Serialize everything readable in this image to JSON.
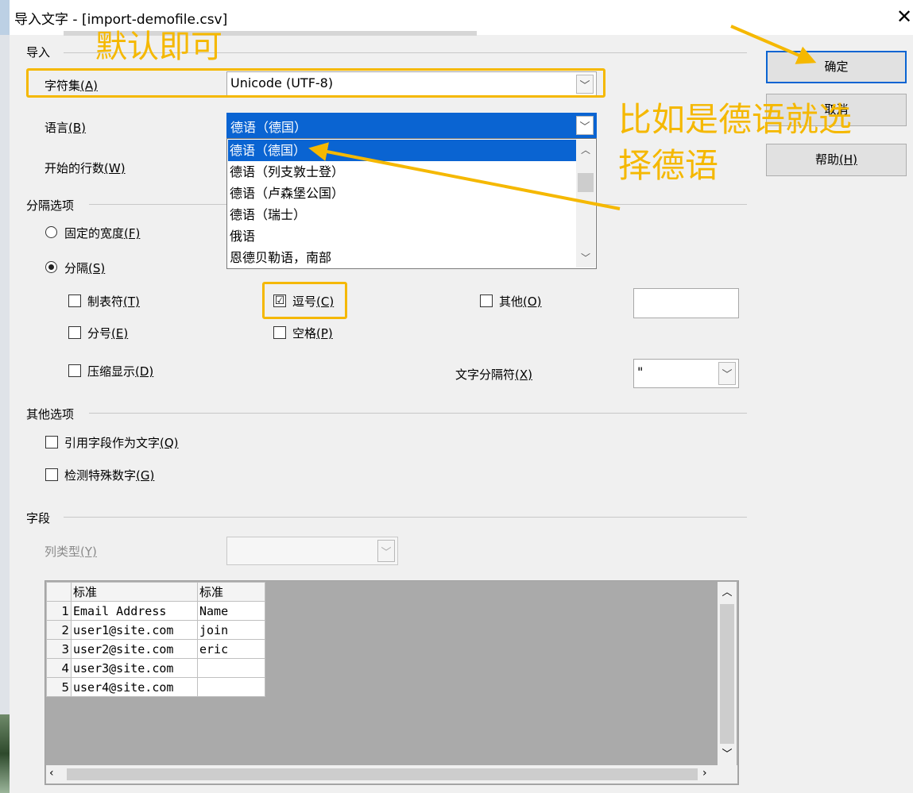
{
  "window": {
    "title": "导入文字 - [import-demofile.csv]",
    "close_glyph": "✕"
  },
  "import_section": {
    "label": "导入",
    "charset_label": "字符集",
    "charset_key": "(A)",
    "charset_value": "Unicode (UTF-8)",
    "language_label": "语言",
    "language_key": "(B)",
    "language_value": "德语（德国）",
    "start_row_label": "开始的行数",
    "start_row_key": "(W)",
    "language_options": [
      "德语（德国）",
      "德语（列支敦士登）",
      "德语（卢森堡公国）",
      "德语（瑞士）",
      "俄语",
      "恩德贝勒语，南部"
    ]
  },
  "separator_section": {
    "label": "分隔选项",
    "fixed_width": "固定的宽度",
    "fixed_width_key": "(F)",
    "separated": "分隔",
    "separated_key": "(S)",
    "tab": "制表符",
    "tab_key": "(T)",
    "comma": "逗号",
    "comma_key": "(C)",
    "other": "其他",
    "other_key": "(O)",
    "semicolon": "分号",
    "semicolon_key": "(E)",
    "space": "空格",
    "space_key": "(P)",
    "merge": "压缩显示",
    "merge_key": "(D)",
    "text_delim_label": "文字分隔符",
    "text_delim_key": "(X)",
    "text_delim_value": "\"",
    "comma_checked": "☑"
  },
  "other_section": {
    "label": "其他选项",
    "quoted_as_text": "引用字段作为文字",
    "quoted_key": "(Q)",
    "detect_numbers": "检测特殊数字",
    "detect_key": "(G)"
  },
  "fields_section": {
    "label": "字段",
    "column_type_label": "列类型",
    "column_type_key": "(Y)",
    "headers": [
      "标准",
      "标准"
    ],
    "rows": [
      {
        "n": "1",
        "c1": "Email Address",
        "c2": "Name"
      },
      {
        "n": "2",
        "c1": "user1@site.com",
        "c2": "join"
      },
      {
        "n": "3",
        "c1": "user2@site.com",
        "c2": "eric"
      },
      {
        "n": "4",
        "c1": "user3@site.com",
        "c2": ""
      },
      {
        "n": "5",
        "c1": "user4@site.com",
        "c2": ""
      }
    ]
  },
  "buttons": {
    "ok": "确定",
    "cancel": "取消",
    "help": "帮助",
    "help_key": "(H)"
  },
  "annotations": {
    "default_note": "默认即可",
    "german_note_line1": "比如是德语就选",
    "german_note_line2": "择德语",
    "color": "#f5b800"
  },
  "icons": {
    "dropdown": "chevron-down-icon",
    "scroll_up": "chevron-up-icon",
    "scroll_left": "chevron-left-icon",
    "scroll_right": "chevron-right-icon"
  }
}
